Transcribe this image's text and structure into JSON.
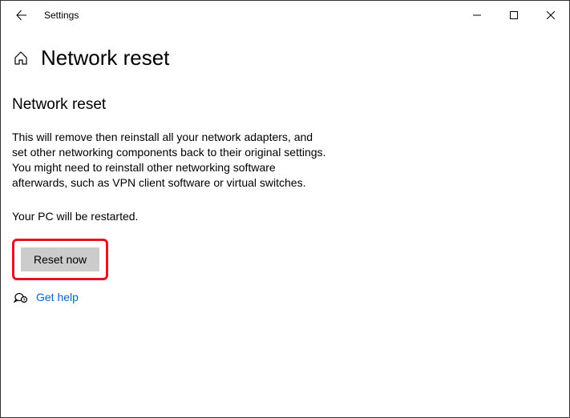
{
  "titlebar": {
    "title": "Settings"
  },
  "header": {
    "title": "Network reset"
  },
  "content": {
    "subtitle": "Network reset",
    "description": "This will remove then reinstall all your network adapters, and set other networking components back to their original settings. You might need to reinstall other networking software afterwards, such as VPN client software or virtual switches.",
    "restart_note": "Your PC will be restarted.",
    "reset_button": "Reset now",
    "help_link": "Get help"
  }
}
